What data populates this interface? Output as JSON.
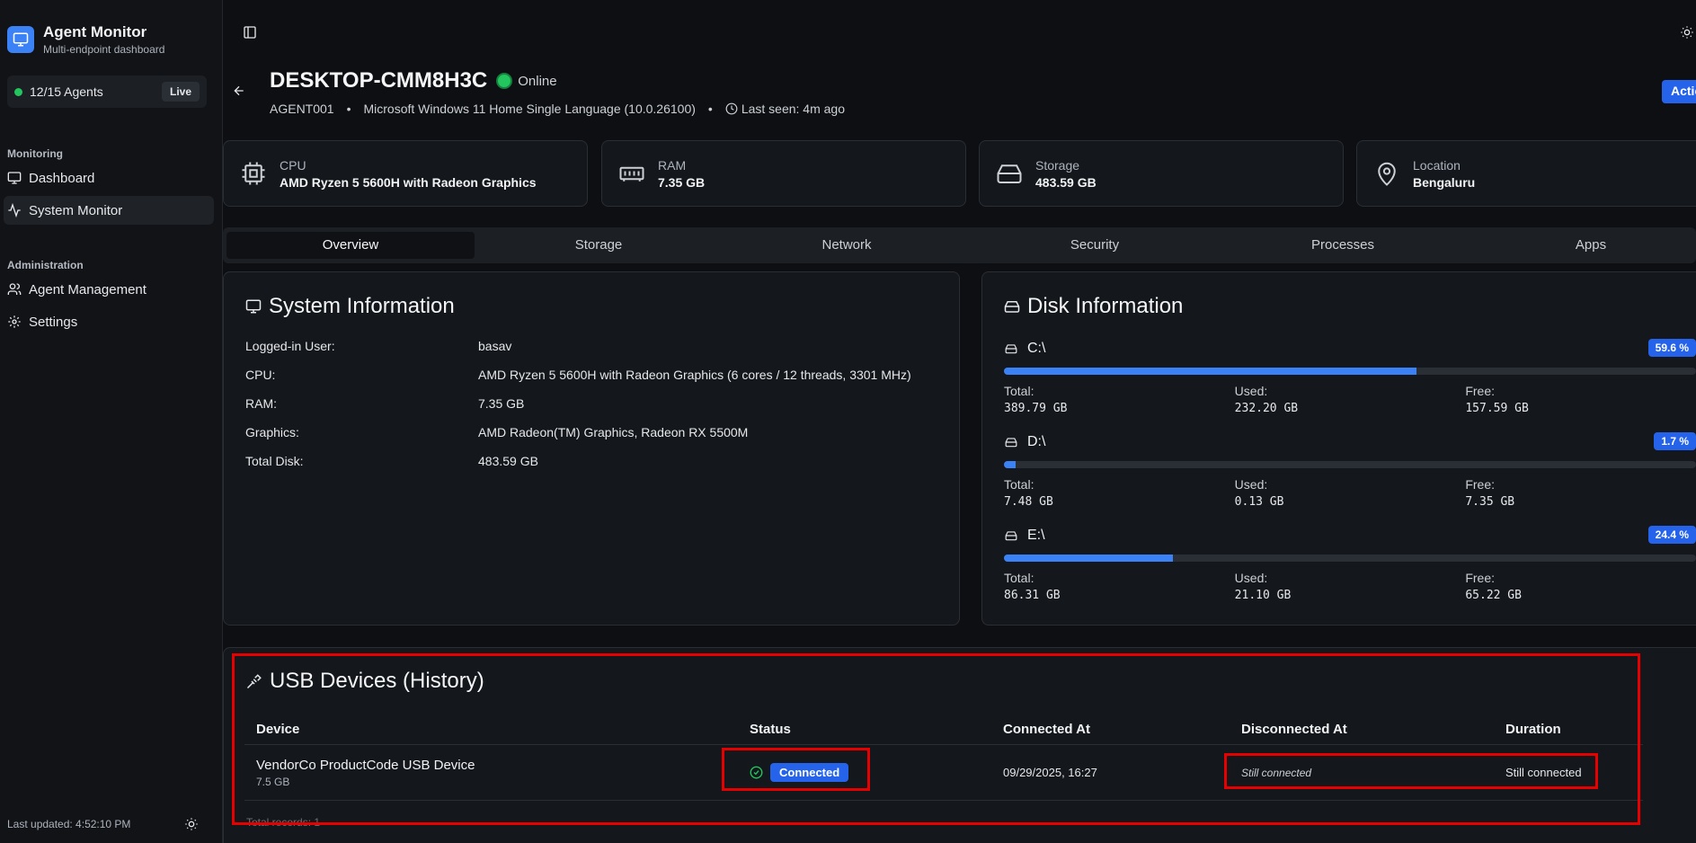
{
  "sidebar": {
    "title": "Agent Monitor",
    "subtitle": "Multi-endpoint dashboard",
    "agents": "12/15 Agents",
    "live": "Live",
    "section_monitoring": "Monitoring",
    "nav_dashboard": "Dashboard",
    "nav_system_monitor": "System Monitor",
    "section_admin": "Administration",
    "nav_agent_mgmt": "Agent Management",
    "nav_settings": "Settings",
    "footer": "Last updated: 4:52:10 PM"
  },
  "header": {
    "hostname": "DESKTOP-CMM8H3C",
    "status": "Online",
    "agent_id": "AGENT001",
    "os": "Microsoft Windows 11 Home Single Language (10.0.26100)",
    "last_seen": "Last seen: 4m ago",
    "action": "Actions"
  },
  "stats": {
    "cpu_label": "CPU",
    "cpu_value": "AMD Ryzen 5 5600H with Radeon Graphics",
    "ram_label": "RAM",
    "ram_value": "7.35 GB",
    "storage_label": "Storage",
    "storage_value": "483.59 GB",
    "location_label": "Location",
    "location_value": "Bengaluru"
  },
  "tabs": [
    "Overview",
    "Storage",
    "Network",
    "Security",
    "Processes",
    "Apps"
  ],
  "system_info": {
    "title": "System Information",
    "rows": [
      {
        "label": "Logged-in User:",
        "value": "basav"
      },
      {
        "label": "CPU:",
        "value": "AMD Ryzen 5 5600H with Radeon Graphics (6 cores / 12 threads, 3301 MHz)"
      },
      {
        "label": "RAM:",
        "value": "7.35 GB"
      },
      {
        "label": "Graphics:",
        "value": "AMD Radeon(TM) Graphics, Radeon RX 5500M"
      },
      {
        "label": "Total Disk:",
        "value": "483.59 GB"
      }
    ]
  },
  "disk_info": {
    "title": "Disk Information",
    "total_label": "Total:",
    "used_label": "Used:",
    "free_label": "Free:",
    "disks": [
      {
        "name": "C:\\",
        "pct_label": "59.6 %",
        "pct": 59.6,
        "total": "389.79 GB",
        "used": "232.20 GB",
        "free": "157.59 GB"
      },
      {
        "name": "D:\\",
        "pct_label": "1.7 %",
        "pct": 1.7,
        "total": "7.48 GB",
        "used": "0.13 GB",
        "free": "7.35 GB"
      },
      {
        "name": "E:\\",
        "pct_label": "24.4 %",
        "pct": 24.4,
        "total": "86.31 GB",
        "used": "21.10 GB",
        "free": "65.22 GB"
      }
    ]
  },
  "usb": {
    "title": "USB Devices (History)",
    "headers": {
      "device": "Device",
      "status": "Status",
      "connected_at": "Connected At",
      "disconnected_at": "Disconnected At",
      "duration": "Duration"
    },
    "row": {
      "device": "VendorCo ProductCode USB Device",
      "size": "7.5 GB",
      "status": "Connected",
      "connected_at": "09/29/2025, 16:27",
      "disconnected_at": "Still connected",
      "duration": "Still connected"
    },
    "total_records": "Total records: 1"
  },
  "colors": {
    "accent": "#2563eb",
    "online": "#22c55e",
    "highlight": "#e60000"
  }
}
